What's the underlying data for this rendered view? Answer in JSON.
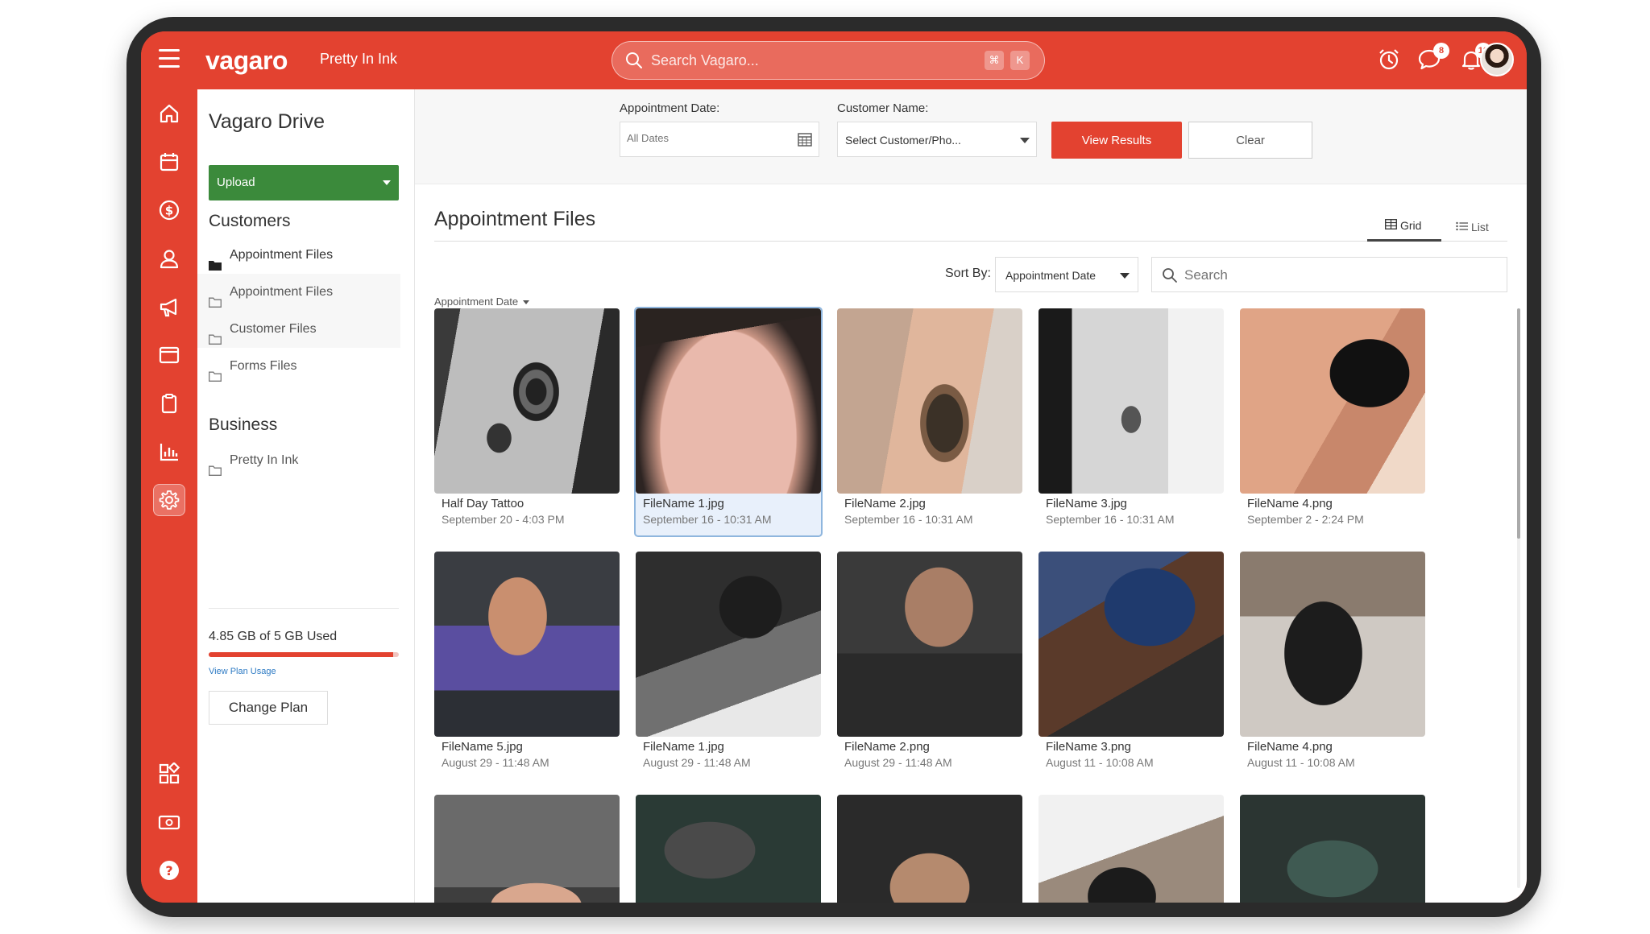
{
  "topbar": {
    "logo": "vagaro",
    "business_name": "Pretty In Ink",
    "search_placeholder": "Search Vagaro...",
    "shortcut_keys": [
      "⌘",
      "K"
    ],
    "messages_count": "8",
    "notifications_count": "10"
  },
  "rail": {
    "items": [
      "home-icon",
      "calendar-icon",
      "dollar-icon",
      "user-icon",
      "megaphone-icon",
      "browser-icon",
      "clipboard-icon",
      "chart-icon",
      "gear-icon",
      "apps-icon",
      "cash-icon",
      "help-icon"
    ],
    "active": "gear-icon"
  },
  "sidebar": {
    "title": "Vagaro Drive",
    "upload_label": "Upload",
    "customers_heading": "Customers",
    "customer_items": [
      {
        "label": "Appointment Files",
        "active": true
      },
      {
        "label": "Appointment Files",
        "active": false
      },
      {
        "label": "Customer Files",
        "active": false
      },
      {
        "label": "Forms Files",
        "active": false
      }
    ],
    "business_heading": "Business",
    "business_items": [
      {
        "label": "Pretty In Ink"
      }
    ],
    "storage_text": "4.85 GB of 5 GB Used",
    "storage_used_fraction": 0.97,
    "view_plan_usage": "View Plan Usage",
    "change_plan": "Change Plan"
  },
  "filters": {
    "date_label": "Appointment Date:",
    "date_placeholder": "All Dates",
    "customer_label": "Customer Name:",
    "customer_value": "Select Customer/Pho...",
    "view_results": "View Results",
    "clear": "Clear"
  },
  "content": {
    "title": "Appointment Files",
    "tabs": [
      {
        "label": "Grid",
        "active": true
      },
      {
        "label": "List",
        "active": false
      }
    ],
    "sort_label": "Sort By:",
    "sort_value": "Appointment Date",
    "search_placeholder": "Search",
    "group_label": "Appointment Date"
  },
  "files": [
    {
      "name": "Half Day Tattoo",
      "date": "September 20 - 4:03 PM",
      "selected": false
    },
    {
      "name": "FileName 1.jpg",
      "date": "September 16 - 10:31 AM",
      "selected": true
    },
    {
      "name": "FileName 2.jpg",
      "date": "September 16 - 10:31 AM",
      "selected": false
    },
    {
      "name": "FileName 3.jpg",
      "date": "September 16 - 10:31 AM",
      "selected": false
    },
    {
      "name": "FileName 4.png",
      "date": "September 2 - 2:24 PM",
      "selected": false
    },
    {
      "name": "FileName 5.jpg",
      "date": "August 29 - 11:48 AM",
      "selected": false
    },
    {
      "name": "FileName 1.jpg",
      "date": "August 29 - 11:48 AM",
      "selected": false
    },
    {
      "name": "FileName 2.png",
      "date": "August 29 - 11:48 AM",
      "selected": false
    },
    {
      "name": "FileName 3.png",
      "date": "August 11 - 10:08 AM",
      "selected": false
    },
    {
      "name": "FileName 4.png",
      "date": "August 11 - 10:08 AM",
      "selected": false
    },
    {
      "name": "",
      "date": "",
      "selected": false
    },
    {
      "name": "",
      "date": "",
      "selected": false
    },
    {
      "name": "",
      "date": "",
      "selected": false
    },
    {
      "name": "",
      "date": "",
      "selected": false
    },
    {
      "name": "",
      "date": "",
      "selected": false
    }
  ]
}
